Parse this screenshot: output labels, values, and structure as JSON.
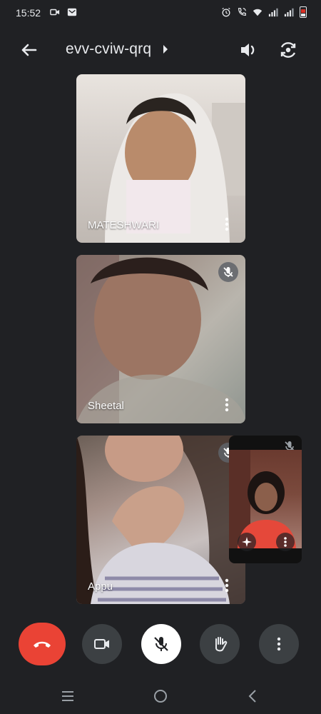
{
  "status_bar": {
    "time": "15:52",
    "left_icons": [
      "video-icon",
      "message-icon"
    ],
    "right_icons": [
      "alarm-icon",
      "wifi-call-icon",
      "wifi-icon",
      "signal-icon",
      "signal-icon",
      "battery-icon"
    ],
    "battery_color": "#d93025"
  },
  "header": {
    "meeting_code": "evv-cviw-qrq",
    "icons": [
      "back-arrow-icon",
      "chevron-right-icon",
      "speaker-icon",
      "flip-camera-icon"
    ]
  },
  "participants": [
    {
      "name": "MATESHWARI",
      "muted": false
    },
    {
      "name": "Sheetal",
      "muted": true
    },
    {
      "name": "Appu",
      "muted": true
    }
  ],
  "self_view": {
    "muted": true,
    "icons": [
      "mic-off-icon",
      "effects-sparkle-icon",
      "more-vert-icon"
    ]
  },
  "controls": {
    "icons": [
      "end-call-icon",
      "camera-icon",
      "mic-off-icon",
      "raise-hand-icon",
      "more-vert-icon"
    ],
    "end_call_color": "#ea4335",
    "button_color": "#3c4043"
  },
  "nav_bar": {
    "icons": [
      "recents-icon",
      "home-icon",
      "back-icon"
    ]
  }
}
